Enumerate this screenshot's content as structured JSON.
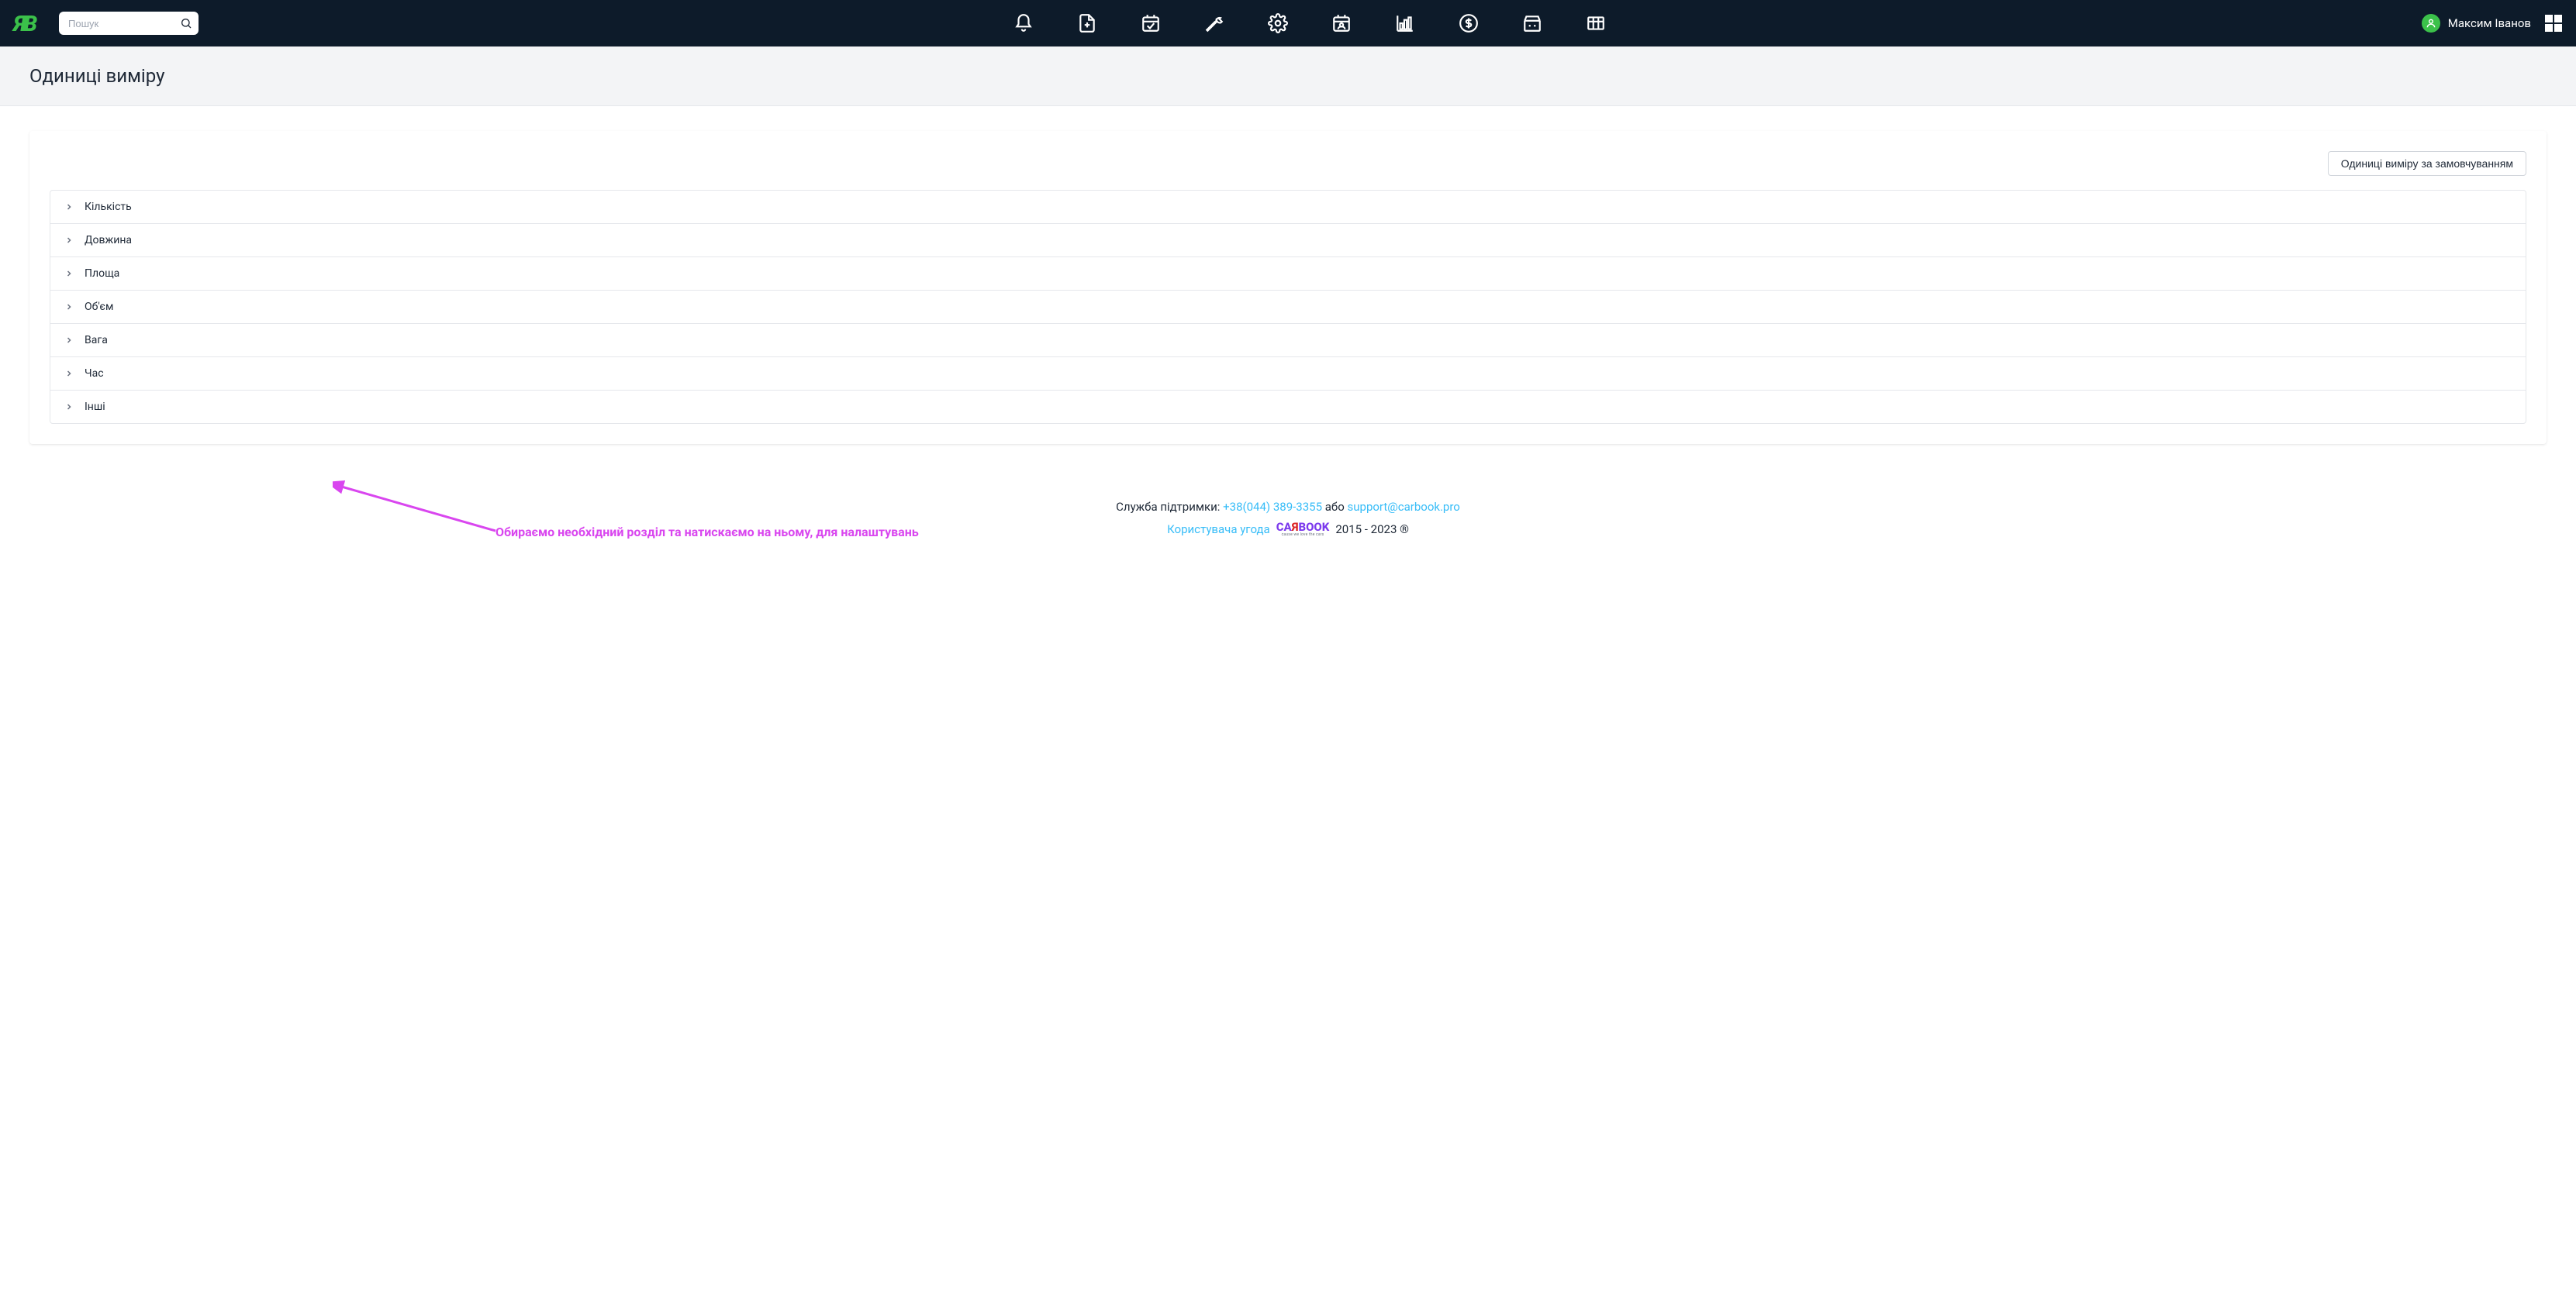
{
  "search": {
    "placeholder": "Пошук"
  },
  "user": {
    "name": "Максим Іванов"
  },
  "page": {
    "title": "Одиниці виміру"
  },
  "buttons": {
    "default_units": "Одиниці виміру за замовчуванням"
  },
  "accordion": {
    "items": [
      {
        "label": "Кількість"
      },
      {
        "label": "Довжина"
      },
      {
        "label": "Площа"
      },
      {
        "label": "Об'єм"
      },
      {
        "label": "Вага"
      },
      {
        "label": "Час"
      },
      {
        "label": "Інші"
      }
    ]
  },
  "annotation": {
    "text": "Обираємо необхідний розділ та натискаємо на ньому, для налаштувань"
  },
  "footer": {
    "support_label": "Служба підтримки:",
    "phone": "+38(044) 389-3355",
    "or": "або",
    "email": "support@carbook.pro",
    "agreement": "Користувача угода",
    "copyright": "2015 - 2023 ®",
    "carbook_tag": "cause we love the cars"
  }
}
